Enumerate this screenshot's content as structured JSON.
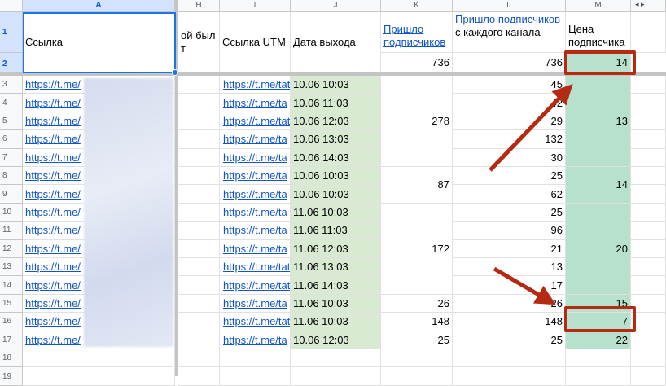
{
  "columns": [
    "A",
    "H",
    "I",
    "J",
    "K",
    "L",
    "M"
  ],
  "row_numbers": [
    "1",
    "2",
    "3",
    "4",
    "5",
    "6",
    "7",
    "8",
    "9",
    "10",
    "11",
    "12",
    "13",
    "14",
    "15",
    "16",
    "17",
    "18",
    "19"
  ],
  "headers": {
    "a": "Ссылка",
    "h": "ой был т",
    "i": "Ссылка UTM",
    "j": "Дата выхода",
    "k_link": "Пришло подписчиков",
    "l_link": "Пришло подписчиков",
    "l_rest": " с каждого канала",
    "m": "Цена подписчика"
  },
  "totals": {
    "k": "736",
    "l": "736",
    "m": "14"
  },
  "rows": [
    {
      "a": "https://t.me/",
      "i": "https://t.me/tat",
      "j": "10.06 10:03",
      "l": "45"
    },
    {
      "a": "https://t.me/",
      "i": "https://t.me/ta",
      "j": "10.06 11:03",
      "l": "42"
    },
    {
      "a": "https://t.me/",
      "i": "https://t.me/tat",
      "j": "10.06 12:03",
      "l": "29"
    },
    {
      "a": "https://t.me/",
      "i": "https://t.me/ta",
      "j": "10.06 13:03",
      "l": "132"
    },
    {
      "a": "https://t.me/",
      "i": "https://t.me/ta",
      "j": "10.06 14:03",
      "l": "30"
    },
    {
      "a": "https://t.me/",
      "i": "https://t.me/ta",
      "j": "10.06 10:03",
      "l": "25"
    },
    {
      "a": "https://t.me/",
      "i": "https://t.me/ta",
      "j": "10.06 10:03",
      "l": "62"
    },
    {
      "a": "https://t.me/",
      "i": "https://t.me/ta",
      "j": "11.06 10:03",
      "l": "25"
    },
    {
      "a": "https://t.me/",
      "i": "https://t.me/ta",
      "j": "11.06 11:03",
      "l": "96"
    },
    {
      "a": "https://t.me/",
      "i": "https://t.me/ta",
      "j": "11.06 12:03",
      "l": "21"
    },
    {
      "a": "https://t.me/",
      "i": "https://t.me/tat",
      "j": "11.06 13:03",
      "l": "13"
    },
    {
      "a": "https://t.me/",
      "i": "https://t.me/tat",
      "j": "11.06 14:03",
      "l": "17"
    },
    {
      "a": "https://t.me/",
      "i": "https://t.me/ta",
      "j": "11.06 10:03",
      "l": "26"
    },
    {
      "a": "https://t.me/",
      "i": "https://t.me/tat",
      "j": "11.06 10:03",
      "l": "148"
    },
    {
      "a": "https://t.me/",
      "i": "https://t.me/ta",
      "j": "10.06 12:03",
      "l": "25"
    }
  ],
  "merged_k": [
    {
      "from": 0,
      "span": 5,
      "value": "278"
    },
    {
      "from": 5,
      "span": 2,
      "value": "87"
    },
    {
      "from": 7,
      "span": 5,
      "value": "172"
    },
    {
      "from": 12,
      "span": 1,
      "value": "26"
    },
    {
      "from": 13,
      "span": 1,
      "value": "148"
    },
    {
      "from": 14,
      "span": 1,
      "value": "25"
    }
  ],
  "merged_m": [
    {
      "from": 0,
      "span": 5,
      "value": "13"
    },
    {
      "from": 5,
      "span": 2,
      "value": "14"
    },
    {
      "from": 7,
      "span": 5,
      "value": "20"
    },
    {
      "from": 12,
      "span": 1,
      "value": "15"
    },
    {
      "from": 13,
      "span": 1,
      "value": "7"
    },
    {
      "from": 14,
      "span": 1,
      "value": "22"
    }
  ],
  "colors": {
    "highlight": "#b7e1cd",
    "date_fill": "#d9ead3",
    "annotation": "#b52a12",
    "selection": "#1a73e8"
  }
}
